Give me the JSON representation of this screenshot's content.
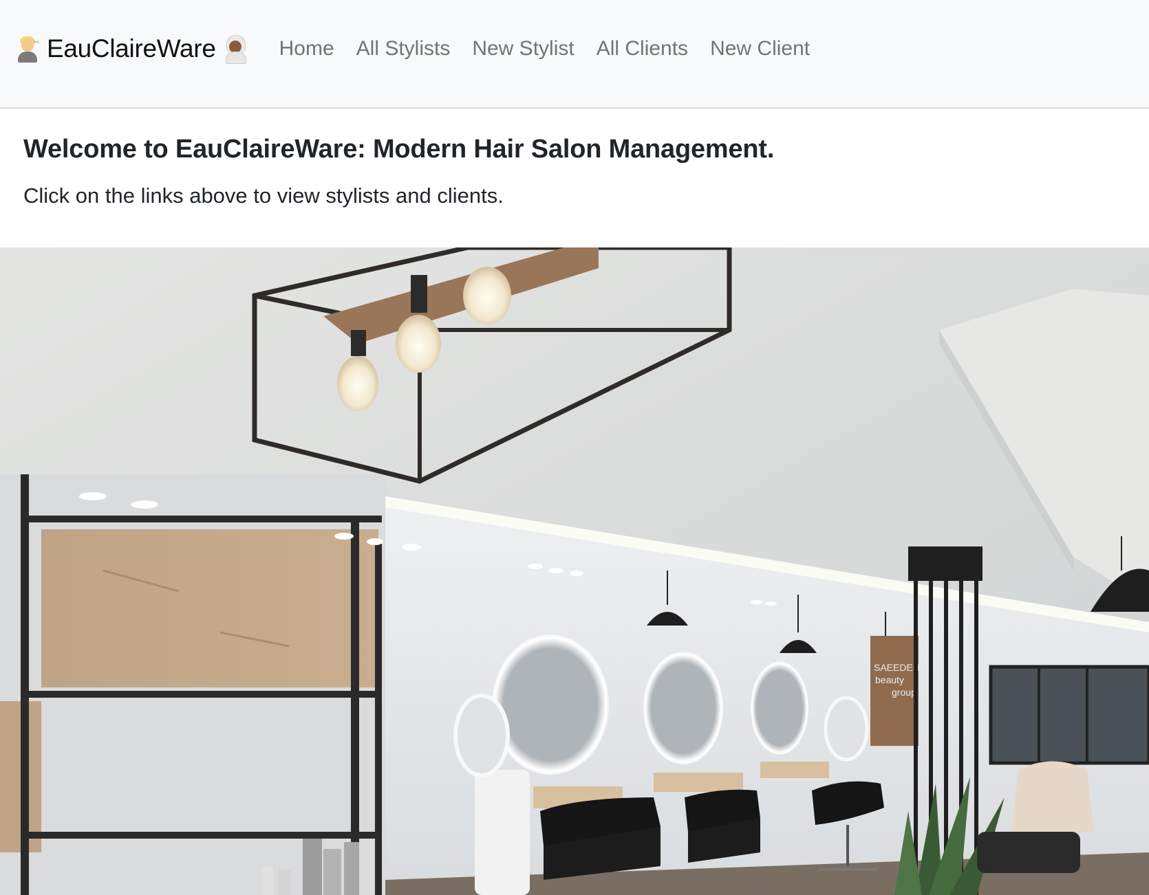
{
  "brand": {
    "name": "EauClaireWare",
    "left_icon": "man-getting-haircut-icon",
    "right_icon": "woman-in-steamy-room-icon"
  },
  "nav": {
    "items": [
      {
        "label": "Home"
      },
      {
        "label": "All Stylists"
      },
      {
        "label": "New Stylist"
      },
      {
        "label": "All Clients"
      },
      {
        "label": "New Client"
      }
    ]
  },
  "main": {
    "headline": "Welcome to EauClaireWare: Modern Hair Salon Management.",
    "subtext": "Click on the links above to view stylists and clients."
  },
  "hero": {
    "image": "salon-interior-photo",
    "sign_text": [
      "SAEEDEH",
      "beauty",
      "group"
    ]
  },
  "colors": {
    "navbar_bg": "#f8f9fa",
    "nav_link": "#737373",
    "text": "#212529"
  }
}
